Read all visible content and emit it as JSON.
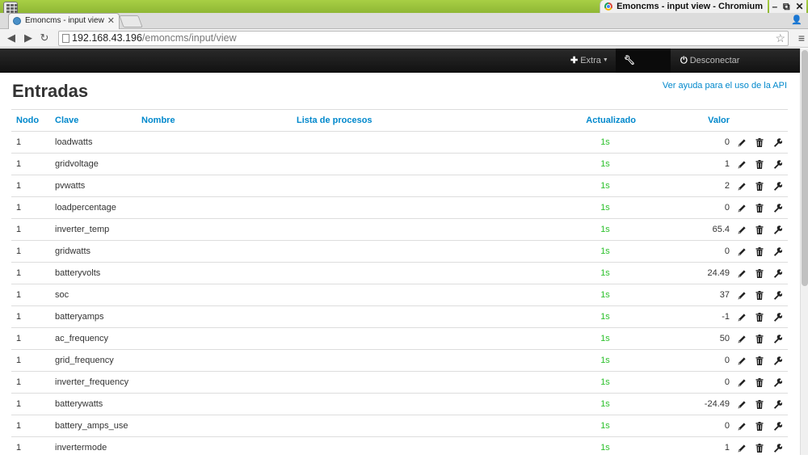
{
  "browser": {
    "window_title": "Emoncms - input view - Chromium",
    "tab_title": "Emoncms - input view",
    "url_host": "192.168.43.196",
    "url_path": "/emoncms/input/view"
  },
  "navbar": {
    "extra_label": "Extra",
    "setup_label": "Setup",
    "logout_label": "Desconectar"
  },
  "page": {
    "title": "Entradas",
    "help_link": "Ver ayuda para el uso de la API"
  },
  "table": {
    "headers": {
      "nodo": "Nodo",
      "clave": "Clave",
      "nombre": "Nombre",
      "lista": "Lista de procesos",
      "actualizado": "Actualizado",
      "valor": "Valor"
    },
    "rows": [
      {
        "nodo": "1",
        "clave": "loadwatts",
        "nombre": "",
        "lista": "",
        "actualizado": "1s",
        "valor": "0"
      },
      {
        "nodo": "1",
        "clave": "gridvoltage",
        "nombre": "",
        "lista": "",
        "actualizado": "1s",
        "valor": "1"
      },
      {
        "nodo": "1",
        "clave": "pvwatts",
        "nombre": "",
        "lista": "",
        "actualizado": "1s",
        "valor": "2"
      },
      {
        "nodo": "1",
        "clave": "loadpercentage",
        "nombre": "",
        "lista": "",
        "actualizado": "1s",
        "valor": "0"
      },
      {
        "nodo": "1",
        "clave": "inverter_temp",
        "nombre": "",
        "lista": "",
        "actualizado": "1s",
        "valor": "65.4"
      },
      {
        "nodo": "1",
        "clave": "gridwatts",
        "nombre": "",
        "lista": "",
        "actualizado": "1s",
        "valor": "0"
      },
      {
        "nodo": "1",
        "clave": "batteryvolts",
        "nombre": "",
        "lista": "",
        "actualizado": "1s",
        "valor": "24.49"
      },
      {
        "nodo": "1",
        "clave": "soc",
        "nombre": "",
        "lista": "",
        "actualizado": "1s",
        "valor": "37"
      },
      {
        "nodo": "1",
        "clave": "batteryamps",
        "nombre": "",
        "lista": "",
        "actualizado": "1s",
        "valor": "-1"
      },
      {
        "nodo": "1",
        "clave": "ac_frequency",
        "nombre": "",
        "lista": "",
        "actualizado": "1s",
        "valor": "50"
      },
      {
        "nodo": "1",
        "clave": "grid_frequency",
        "nombre": "",
        "lista": "",
        "actualizado": "1s",
        "valor": "0"
      },
      {
        "nodo": "1",
        "clave": "inverter_frequency",
        "nombre": "",
        "lista": "",
        "actualizado": "1s",
        "valor": "0"
      },
      {
        "nodo": "1",
        "clave": "batterywatts",
        "nombre": "",
        "lista": "",
        "actualizado": "1s",
        "valor": "-24.49"
      },
      {
        "nodo": "1",
        "clave": "battery_amps_use",
        "nombre": "",
        "lista": "",
        "actualizado": "1s",
        "valor": "0"
      },
      {
        "nodo": "1",
        "clave": "invertermode",
        "nombre": "",
        "lista": "",
        "actualizado": "1s",
        "valor": "1"
      }
    ]
  },
  "colors": {
    "link": "#0088cc",
    "updated": "#2fc22f",
    "navbar": "#1b1b1b",
    "titlebar": "#9cc33d"
  },
  "icons": {
    "row_actions": [
      "pencil-icon",
      "trash-icon",
      "wrench-icon"
    ]
  }
}
